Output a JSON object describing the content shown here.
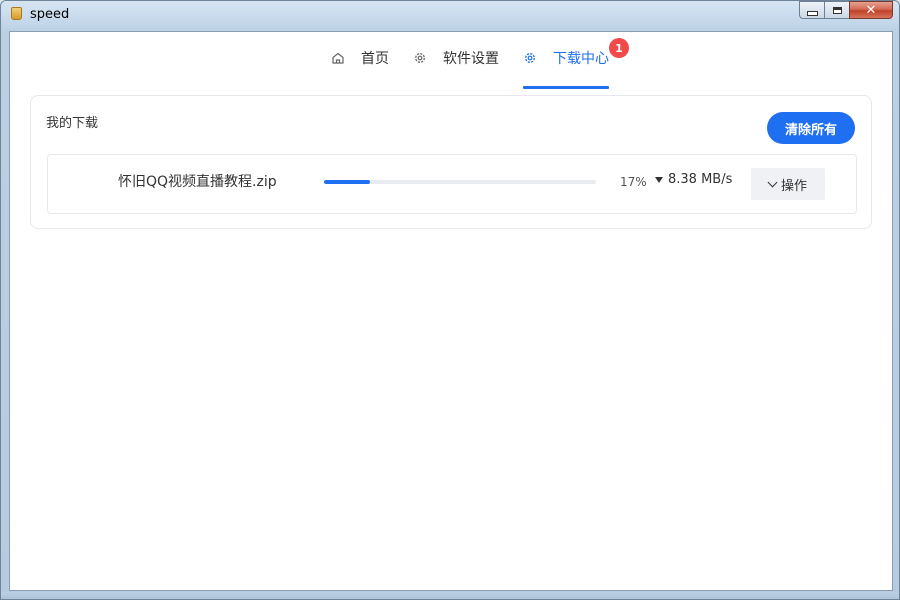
{
  "window": {
    "title": "speed",
    "controls": {
      "minimize": "minimize",
      "maximize": "maximize",
      "close": "close"
    }
  },
  "nav": {
    "tabs": [
      {
        "label": "首页",
        "icon": "home-icon",
        "active": false
      },
      {
        "label": "软件设置",
        "icon": "gear-icon",
        "active": false
      },
      {
        "label": "下载中心",
        "icon": "gear-icon",
        "active": true,
        "badge": "1"
      }
    ]
  },
  "downloads": {
    "title": "我的下载",
    "clear_all_label": "清除所有",
    "items": [
      {
        "filename": "怀旧QQ视频直播教程.zip",
        "progress_percent": 17,
        "progress_text": "17%",
        "speed": "8.38 MB/s",
        "action_label": "操作"
      }
    ]
  },
  "colors": {
    "accent": "#1e6ff1",
    "badge": "#f04a4a"
  }
}
